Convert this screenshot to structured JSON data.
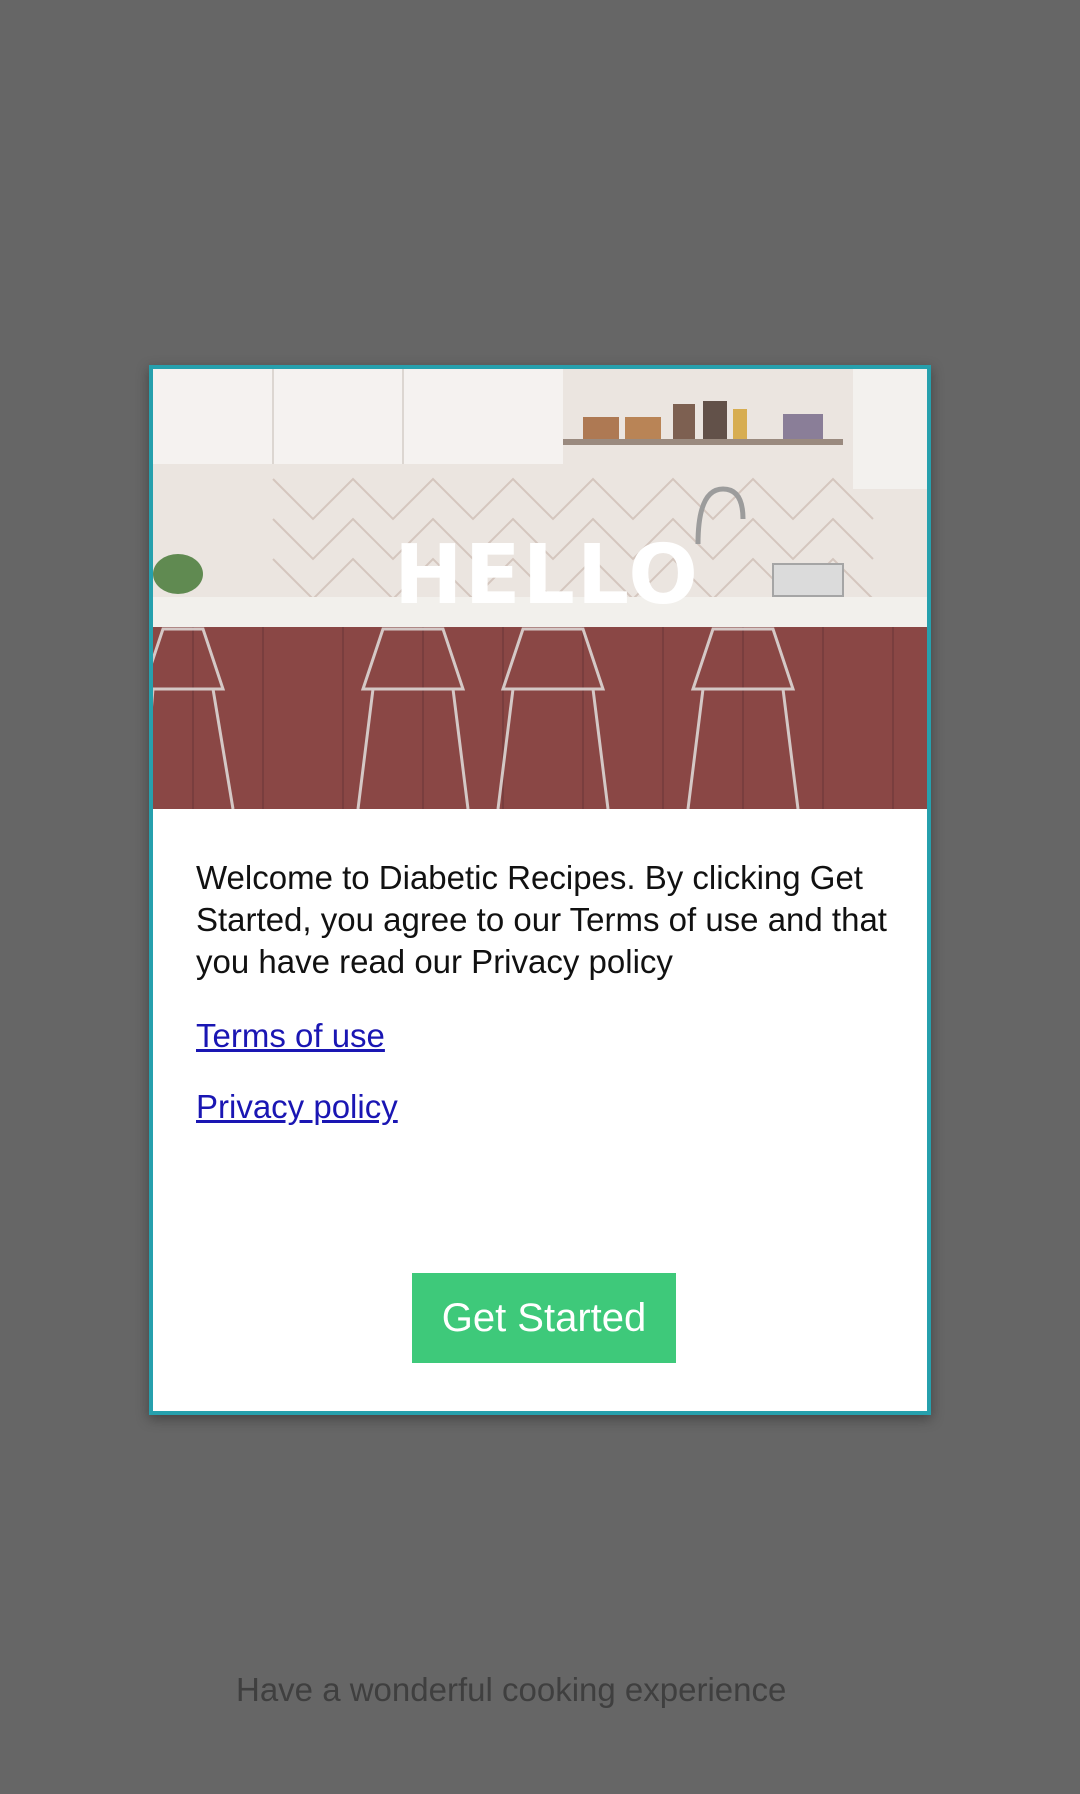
{
  "hero": {
    "title": "HELLO",
    "image_icon": "kitchen-illustration"
  },
  "welcome_text": "Welcome to Diabetic Recipes. By clicking Get Started, you agree to our Terms of use and that you have read our Privacy policy",
  "links": {
    "terms": "Terms of use",
    "privacy": "Privacy policy"
  },
  "button": {
    "get_started": "Get Started"
  },
  "footer": {
    "tagline": "Have a wonderful cooking experience"
  },
  "colors": {
    "background": "#666666",
    "card_border": "#26a0ad",
    "button": "#3ec97a",
    "link": "#1a16b3"
  }
}
